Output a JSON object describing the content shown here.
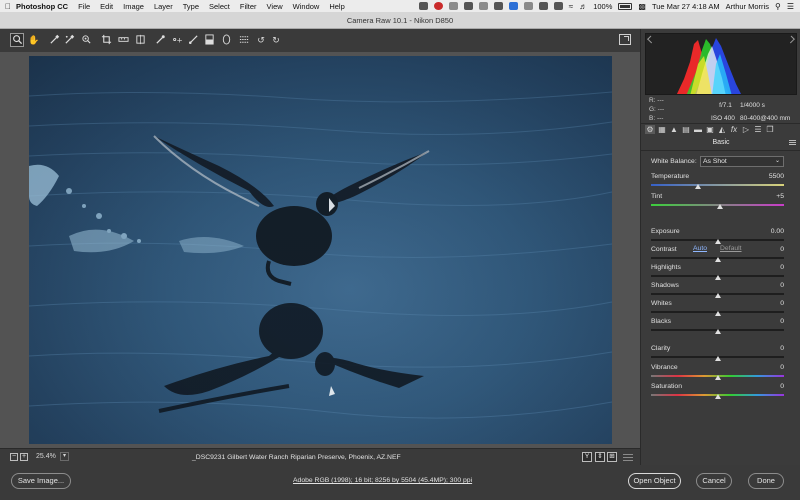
{
  "menubar": {
    "app_name": "Photoshop CC",
    "items": [
      "File",
      "Edit",
      "Image",
      "Layer",
      "Type",
      "Select",
      "Filter",
      "View",
      "Window",
      "Help"
    ],
    "battery": "100%",
    "datetime": "Tue Mar 27  4:18 AM",
    "user": "Arthur Morris"
  },
  "window": {
    "title": "Camera Raw 10.1  -  Nikon D850"
  },
  "toolbar": {
    "tools": [
      "zoom-tool",
      "hand-tool",
      "white-balance-tool",
      "color-sampler-tool",
      "crop-tool",
      "straighten-tool",
      "transform-tool",
      "spot-removal-tool",
      "red-eye-tool",
      "adjustment-brush-tool",
      "graduated-filter-tool",
      "radial-filter-tool",
      "presets-tool",
      "rotate-ccw-tool",
      "rotate-cw-tool"
    ],
    "active_tool": "zoom-tool"
  },
  "status": {
    "zoom": "25.4%",
    "zoom_minus": "−",
    "zoom_plus": "+",
    "dropdown_glyph": "▾",
    "filename": "_DSC9231  Gilbert Water Ranch Riparian Preserve, Phoenix, AZ.NEF",
    "view_y": "Y",
    "view_swap": "⇕",
    "view_split": "⊞"
  },
  "bottom": {
    "save_label": "Save Image...",
    "workflow_text": "Adobe RGB (1998); 16 bit; 8256 by 5504 (45.4MP); 300 ppi",
    "open_label": "Open Object",
    "cancel_label": "Cancel",
    "done_label": "Done"
  },
  "readout": {
    "r": "R:   ---",
    "g": "G:   ---",
    "b": "B:   ---"
  },
  "exif": {
    "aperture": "f/7.1",
    "shutter": "1/4000 s",
    "iso": "ISO 400",
    "lens": "80-400@400 mm"
  },
  "panel": {
    "title": "Basic",
    "white_balance_label": "White Balance:",
    "white_balance_value": "As Shot",
    "chevron": "⌄",
    "auto_label": "Auto",
    "default_label": "Default",
    "sliders": [
      {
        "id": "temperature",
        "label": "Temperature",
        "value": "5500",
        "level": 0.35
      },
      {
        "id": "tint",
        "label": "Tint",
        "value": "+5",
        "level": 0.52
      },
      {
        "id": "exposure",
        "label": "Exposure",
        "value": "0.00",
        "level": 0.5
      },
      {
        "id": "contrast",
        "label": "Contrast",
        "value": "0",
        "level": 0.5
      },
      {
        "id": "highlights",
        "label": "Highlights",
        "value": "0",
        "level": 0.5
      },
      {
        "id": "shadows",
        "label": "Shadows",
        "value": "0",
        "level": 0.5
      },
      {
        "id": "whites",
        "label": "Whites",
        "value": "0",
        "level": 0.5
      },
      {
        "id": "blacks",
        "label": "Blacks",
        "value": "0",
        "level": 0.5
      },
      {
        "id": "clarity",
        "label": "Clarity",
        "value": "0",
        "level": 0.5
      },
      {
        "id": "vibrance",
        "label": "Vibrance",
        "value": "0",
        "level": 0.5
      },
      {
        "id": "saturation",
        "label": "Saturation",
        "value": "0",
        "level": 0.5
      }
    ]
  },
  "colors": {
    "panel_bg": "#3b3b3b",
    "canvas_bg": "#535353",
    "accent_link": "#8fb7ff"
  }
}
